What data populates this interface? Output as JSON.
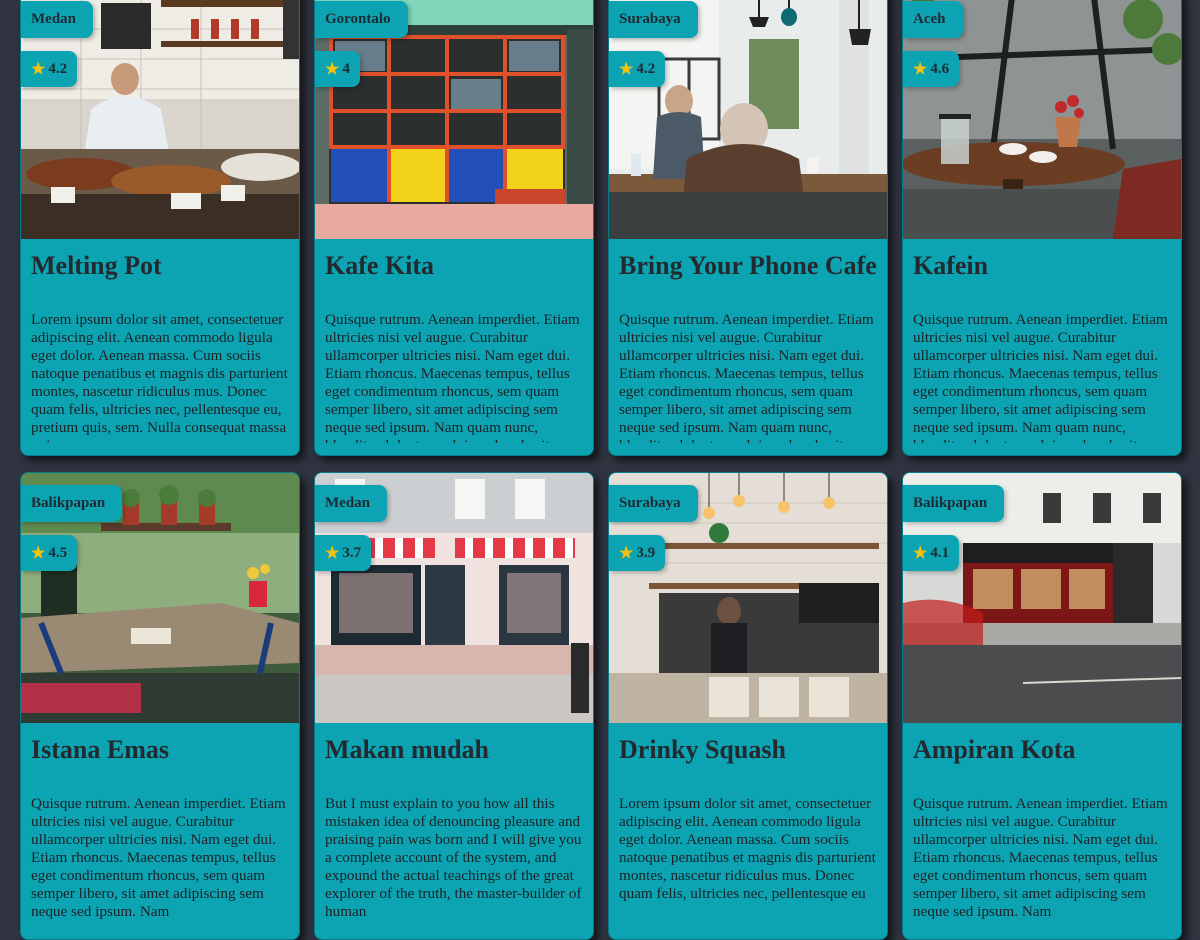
{
  "cards": [
    {
      "city": "Medan",
      "rating": "4.2",
      "name": "Melting Pot",
      "description": "Lorem ipsum dolor sit amet, consectetuer adipiscing elit. Aenean commodo ligula eget dolor. Aenean massa. Cum sociis natoque penatibus et magnis dis parturient montes, nascetur ridiculus mus. Donec quam felis, ultricies nec, pellentesque eu, pretium quis, sem. Nulla consequat massa quis"
    },
    {
      "city": "Gorontalo",
      "rating": "4",
      "name": "Kafe Kita",
      "description": "Quisque rutrum. Aenean imperdiet. Etiam ultricies nisi vel augue. Curabitur ullamcorper ultricies nisi. Nam eget dui. Etiam rhoncus. Maecenas tempus, tellus eget condimentum rhoncus, sem quam semper libero, sit amet adipiscing sem neque sed ipsum. Nam quam nunc, blandit vel, luctus pulvinar, hendrerit"
    },
    {
      "city": "Surabaya",
      "rating": "4.2",
      "name": "Bring Your Phone Cafe",
      "description": "Quisque rutrum. Aenean imperdiet. Etiam ultricies nisi vel augue. Curabitur ullamcorper ultricies nisi. Nam eget dui. Etiam rhoncus. Maecenas tempus, tellus eget condimentum rhoncus, sem quam semper libero, sit amet adipiscing sem neque sed ipsum. Nam quam nunc, blandit vel, luctus pulvinar, hendrerit"
    },
    {
      "city": "Aceh",
      "rating": "4.6",
      "name": "Kafein",
      "description": "Quisque rutrum. Aenean imperdiet. Etiam ultricies nisi vel augue. Curabitur ullamcorper ultricies nisi. Nam eget dui. Etiam rhoncus. Maecenas tempus, tellus eget condimentum rhoncus, sem quam semper libero, sit amet adipiscing sem neque sed ipsum. Nam quam nunc, blandit vel, luctus pulvinar, hendrerit"
    },
    {
      "city": "Balikpapan",
      "rating": "4.5",
      "name": "Istana Emas",
      "description": "Quisque rutrum. Aenean imperdiet. Etiam ultricies nisi vel augue. Curabitur ullamcorper ultricies nisi. Nam eget dui. Etiam rhoncus. Maecenas tempus, tellus eget condimentum rhoncus, sem quam semper libero, sit amet adipiscing sem neque sed ipsum. Nam"
    },
    {
      "city": "Medan",
      "rating": "3.7",
      "name": "Makan mudah",
      "description": "But I must explain to you how all this mistaken idea of denouncing pleasure and praising pain was born and I will give you a complete account of the system, and expound the actual teachings of the great explorer of the truth, the master-builder of human"
    },
    {
      "city": "Surabaya",
      "rating": "3.9",
      "name": "Drinky Squash",
      "description": "Lorem ipsum dolor sit amet, consectetuer adipiscing elit. Aenean commodo ligula eget dolor. Aenean massa. Cum sociis natoque penatibus et magnis dis parturient montes, nascetur ridiculus mus. Donec quam felis, ultricies nec, pellentesque eu"
    },
    {
      "city": "Balikpapan",
      "rating": "4.1",
      "name": "Ampiran Kota",
      "description": "Quisque rutrum. Aenean imperdiet. Etiam ultricies nisi vel augue. Curabitur ullamcorper ultricies nisi. Nam eget dui. Etiam rhoncus. Maecenas tempus, tellus eget condimentum rhoncus, sem quam semper libero, sit amet adipiscing sem neque sed ipsum. Nam"
    }
  ],
  "icons": {
    "rating": "star-icon"
  },
  "colors": {
    "card": "#0ca4b2",
    "background": "#2f3440",
    "star": "#f4c20d"
  }
}
